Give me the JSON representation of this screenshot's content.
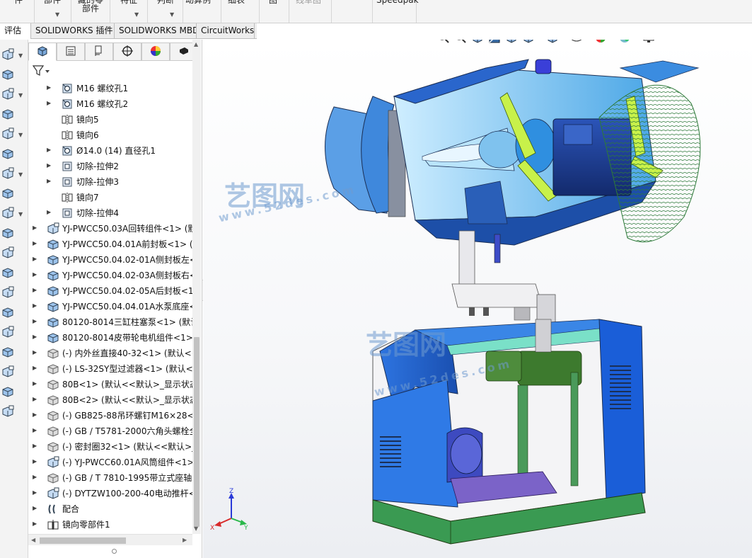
{
  "ribbon": {
    "groups": [
      {
        "label": "件",
        "gray": false
      },
      {
        "label": "部件",
        "gray": false
      },
      {
        "label": "藏的零\n部件",
        "gray": false
      },
      {
        "label": "特征",
        "gray": false
      },
      {
        "label": "判断",
        "gray": false
      },
      {
        "label": "动算例",
        "gray": false
      },
      {
        "label": "细表",
        "gray": false
      },
      {
        "label": "图",
        "gray": false
      },
      {
        "label": "线草图",
        "gray": true
      },
      {
        "label": "Speedpak",
        "gray": false
      }
    ]
  },
  "tabs": [
    {
      "label": "评估",
      "active": true
    },
    {
      "label": "SOLIDWORKS 插件",
      "active": false
    },
    {
      "label": "SOLIDWORKS MBD",
      "active": false
    },
    {
      "label": "CircuitWorks",
      "active": false
    }
  ],
  "feature_manager": {
    "panel_tabs": [
      "feature-manager-icon",
      "property-manager-icon",
      "configuration-manager-icon",
      "dimxpert-icon",
      "display-manager-icon",
      "cam-icon"
    ],
    "filter_icon": "filter-icon",
    "tree": [
      {
        "label": "M16 螺纹孔1",
        "level": 2,
        "expandable": true,
        "icon": "hole-wizard-icon"
      },
      {
        "label": "M16 螺纹孔2",
        "level": 2,
        "expandable": true,
        "icon": "hole-wizard-icon"
      },
      {
        "label": "镜向5",
        "level": 2,
        "expandable": false,
        "icon": "mirror-icon"
      },
      {
        "label": "镜向6",
        "level": 2,
        "expandable": false,
        "icon": "mirror-icon"
      },
      {
        "label": "Ø14.0 (14) 直径孔1",
        "level": 2,
        "expandable": true,
        "icon": "hole-wizard-icon"
      },
      {
        "label": "切除-拉伸2",
        "level": 2,
        "expandable": true,
        "icon": "cut-extrude-icon"
      },
      {
        "label": "切除-拉伸3",
        "level": 2,
        "expandable": true,
        "icon": "cut-extrude-icon"
      },
      {
        "label": "镜向7",
        "level": 2,
        "expandable": false,
        "icon": "mirror-icon"
      },
      {
        "label": "切除-拉伸4",
        "level": 2,
        "expandable": true,
        "icon": "cut-extrude-icon"
      },
      {
        "label": "YJ-PWCC50.03A回转组件<1> (默",
        "level": 1,
        "expandable": true,
        "icon": "subassembly-icon"
      },
      {
        "label": "YJ-PWCC50.04.01A前封板<1> (默",
        "level": 1,
        "expandable": true,
        "icon": "part-icon"
      },
      {
        "label": "YJ-PWCC50.04.02-01A侧封板左<",
        "level": 1,
        "expandable": true,
        "icon": "part-icon"
      },
      {
        "label": "YJ-PWCC50.04.02-03A侧封板右<",
        "level": 1,
        "expandable": true,
        "icon": "part-icon"
      },
      {
        "label": "YJ-PWCC50.04.02-05A后封板<1:",
        "level": 1,
        "expandable": true,
        "icon": "part-icon"
      },
      {
        "label": "YJ-PWCC50.04.04.01A水泵底座<",
        "level": 1,
        "expandable": true,
        "icon": "part-icon"
      },
      {
        "label": "80120-8014三缸柱塞泵<1> (默认",
        "level": 1,
        "expandable": true,
        "icon": "part-icon"
      },
      {
        "label": "80120-8014皮带轮电机组件<1>",
        "level": 1,
        "expandable": true,
        "icon": "part-icon"
      },
      {
        "label": "(-) 内外丝直接40-32<1> (默认<<",
        "level": 1,
        "expandable": true,
        "icon": "part-gray-icon"
      },
      {
        "label": "(-) LS-32SY型过滤器<1> (默认<<",
        "level": 1,
        "expandable": true,
        "icon": "part-gray-icon"
      },
      {
        "label": "80B<1> (默认<<默认>_显示状态",
        "level": 1,
        "expandable": true,
        "icon": "part-gray-icon"
      },
      {
        "label": "80B<2> (默认<<默认>_显示状态",
        "level": 1,
        "expandable": true,
        "icon": "part-gray-icon"
      },
      {
        "label": "(-) GB825-88吊环螺钉M16×28<",
        "level": 1,
        "expandable": true,
        "icon": "part-gray-icon"
      },
      {
        "label": "(-) GB / T5781-2000六角头螺栓全",
        "level": 1,
        "expandable": true,
        "icon": "part-gray-icon"
      },
      {
        "label": "(-) 密封圈32<1> (默认<<默认>_显",
        "level": 1,
        "expandable": true,
        "icon": "part-gray-icon"
      },
      {
        "label": "(-) YJ-PWCC60.01A风筒组件<1>",
        "level": 1,
        "expandable": true,
        "icon": "subassembly-icon"
      },
      {
        "label": "(-) GB / T 7810-1995带立式座轴承",
        "level": 1,
        "expandable": true,
        "icon": "part-gray-icon"
      },
      {
        "label": "(-) DYTZW100-200-40电动推杆<",
        "level": 1,
        "expandable": true,
        "icon": "subassembly-icon"
      },
      {
        "label": "配合",
        "level": 1,
        "expandable": true,
        "icon": "mates-icon"
      },
      {
        "label": "镜向零部件1",
        "level": 1,
        "expandable": true,
        "icon": "mirror-component-icon"
      }
    ]
  },
  "left_strip": {
    "icons": [
      "insert-component-icon",
      "mate-icon",
      "linear-pattern-icon",
      "smart-fastener-icon",
      "move-component-icon",
      "show-hidden-icon",
      "assembly-features-icon",
      "reference-geometry-icon",
      "new-motion-study-icon",
      "bom-icon",
      "exploded-view-icon",
      "explode-line-sketch-icon",
      "instant3d-icon",
      "update-speedpak-icon",
      "take-snapshot-icon",
      "large-assembly-icon",
      "interference-icon",
      "clearance-icon",
      "measure-icon"
    ]
  },
  "headsup": {
    "icons": [
      "zoom-to-fit-icon",
      "zoom-area-icon",
      "previous-view-icon",
      "section-view-icon",
      "dynamic-annotation-icon",
      "view-orientation-icon",
      "display-style-icon",
      "hide-show-items-icon",
      "edit-appearance-icon",
      "apply-scene-icon",
      "view-settings-icon"
    ]
  },
  "triad": {
    "x_label": "X",
    "y_label": "Y",
    "z_label": "Z"
  },
  "watermark": {
    "brand": "艺图网",
    "url": "www.52des.com"
  }
}
